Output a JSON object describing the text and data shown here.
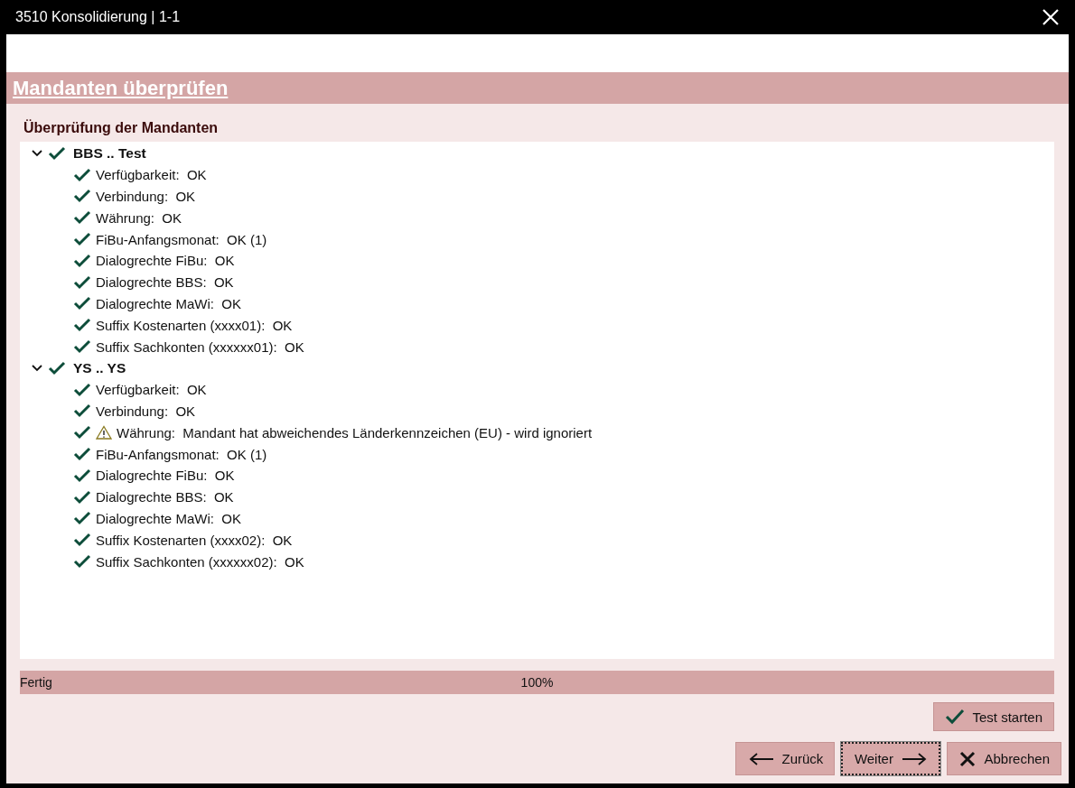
{
  "window": {
    "title": "3510 Konsolidierung | 1-1"
  },
  "page_title": "Mandanten überprüfen",
  "section_title": "Überprüfung der Mandanten",
  "tree": [
    {
      "label": "BBS .. Test",
      "checked": true,
      "expanded": true,
      "children": [
        {
          "label": "Verfügbarkeit:  OK",
          "checked": true,
          "warning": false
        },
        {
          "label": "Verbindung:  OK",
          "checked": true,
          "warning": false
        },
        {
          "label": "Währung:  OK",
          "checked": true,
          "warning": false
        },
        {
          "label": "FiBu-Anfangsmonat:  OK (1)",
          "checked": true,
          "warning": false
        },
        {
          "label": "Dialogrechte FiBu:  OK",
          "checked": true,
          "warning": false
        },
        {
          "label": "Dialogrechte BBS:  OK",
          "checked": true,
          "warning": false
        },
        {
          "label": "Dialogrechte MaWi:  OK",
          "checked": true,
          "warning": false
        },
        {
          "label": "Suffix Kostenarten (xxxx01):  OK",
          "checked": true,
          "warning": false
        },
        {
          "label": "Suffix Sachkonten (xxxxxx01):  OK",
          "checked": true,
          "warning": false
        }
      ]
    },
    {
      "label": "YS .. YS",
      "checked": true,
      "expanded": true,
      "children": [
        {
          "label": "Verfügbarkeit:  OK",
          "checked": true,
          "warning": false
        },
        {
          "label": "Verbindung:  OK",
          "checked": true,
          "warning": false
        },
        {
          "label": "Währung:  Mandant hat abweichendes Länderkennzeichen (EU) - wird ignoriert",
          "checked": true,
          "warning": true
        },
        {
          "label": "FiBu-Anfangsmonat:  OK (1)",
          "checked": true,
          "warning": false
        },
        {
          "label": "Dialogrechte FiBu:  OK",
          "checked": true,
          "warning": false
        },
        {
          "label": "Dialogrechte BBS:  OK",
          "checked": true,
          "warning": false
        },
        {
          "label": "Dialogrechte MaWi:  OK",
          "checked": true,
          "warning": false
        },
        {
          "label": "Suffix Kostenarten (xxxx02):  OK",
          "checked": true,
          "warning": false
        },
        {
          "label": "Suffix Sachkonten (xxxxxx02):  OK",
          "checked": true,
          "warning": false
        }
      ]
    }
  ],
  "progress": {
    "status": "Fertig",
    "percent": "100%",
    "level": 1
  },
  "buttons": [
    {
      "label": "Test starten",
      "kind": "check",
      "focused": false
    },
    {
      "label": "Zurück",
      "kind": "back",
      "focused": false
    },
    {
      "label": "Weiter",
      "kind": "next",
      "focused": true
    },
    {
      "label": "Abbrechen",
      "kind": "cancel",
      "focused": false
    }
  ]
}
